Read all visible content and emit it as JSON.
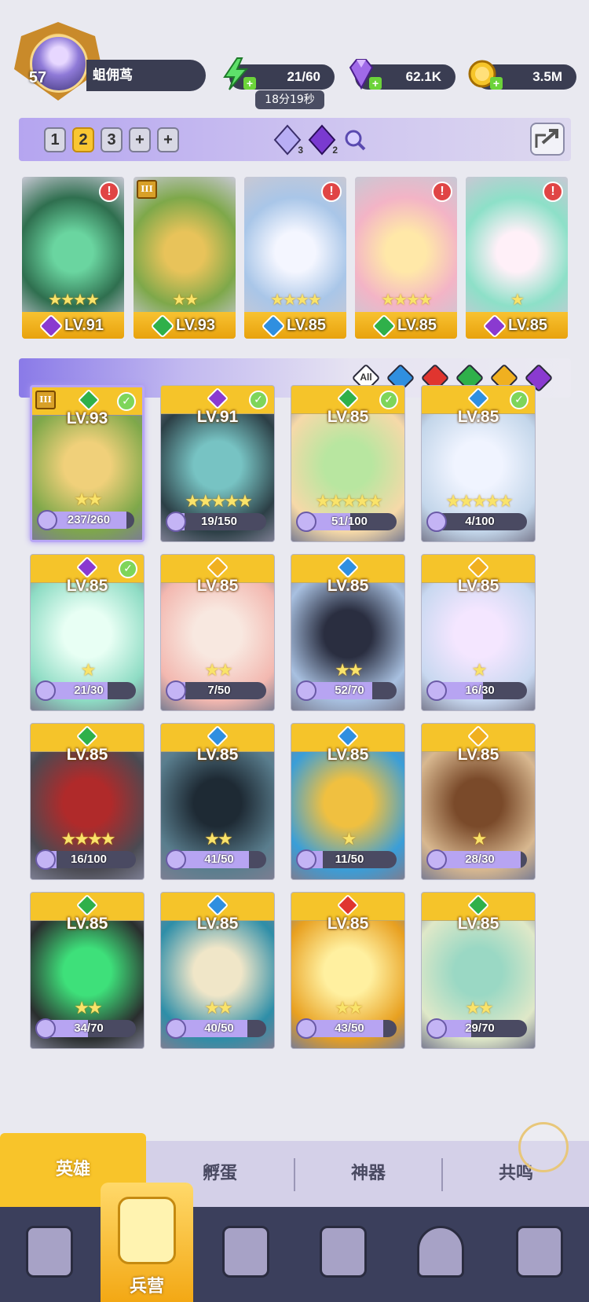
{
  "player": {
    "level": "57",
    "name": "蛆佣茑"
  },
  "resources": {
    "energy": "21/60",
    "energy_timer": "18分19秒",
    "gems": "62.1K",
    "gold": "3.5M"
  },
  "teams": {
    "tabs": [
      "1",
      "2",
      "3",
      "+",
      "+"
    ],
    "active": 1
  },
  "team_gems": [
    {
      "count": "3",
      "color": "#9a8cf0"
    },
    {
      "count": "2",
      "color": "#7a3ad0"
    }
  ],
  "lineup": [
    {
      "level": "LV.91",
      "element": "dark",
      "stars": "★★★★",
      "alert": "!",
      "colors": [
        "#2f6f4f",
        "#6ad5a0"
      ]
    },
    {
      "level": "LV.93",
      "element": "wind",
      "stars": "★★",
      "alert": "",
      "colors": [
        "#7ea84a",
        "#e8c35a"
      ],
      "roman": "III"
    },
    {
      "level": "LV.85",
      "element": "water",
      "stars": "★★★★",
      "alert": "!",
      "colors": [
        "#a9c6e8",
        "#f4f6ff"
      ]
    },
    {
      "level": "LV.85",
      "element": "wind",
      "stars": "★★★★",
      "alert": "!",
      "colors": [
        "#f3b4c6",
        "#ffe8a8"
      ]
    },
    {
      "level": "LV.85",
      "element": "dark",
      "stars": "★",
      "alert": "!",
      "colors": [
        "#8de0c8",
        "#fff0f8"
      ]
    }
  ],
  "filters": [
    {
      "id": "all",
      "label": "All",
      "color": "#ffffff"
    },
    {
      "id": "water",
      "label": "",
      "color": "#2f8fe0"
    },
    {
      "id": "fire",
      "label": "",
      "color": "#e0352f"
    },
    {
      "id": "wind",
      "label": "",
      "color": "#2fb04a"
    },
    {
      "id": "light",
      "label": "",
      "color": "#f0b020"
    },
    {
      "id": "dark",
      "label": "",
      "color": "#8a3ad0"
    }
  ],
  "element_colors": {
    "water": "#2f8fe0",
    "fire": "#e0352f",
    "wind": "#2fb04a",
    "light": "#f0b020",
    "dark": "#8a3ad0"
  },
  "heroes": [
    {
      "level": "LV.93",
      "element": "wind",
      "stars": "★★",
      "shards": "237/260",
      "progress": 0.91,
      "checked": true,
      "selected": true,
      "roman": "III",
      "colors": [
        "#7ea84a",
        "#f0d07a"
      ]
    },
    {
      "level": "LV.91",
      "element": "dark",
      "stars": "★★★★★",
      "shards": "19/150",
      "progress": 0.13,
      "checked": true,
      "colors": [
        "#2c3f46",
        "#77c3c3"
      ]
    },
    {
      "level": "LV.85",
      "element": "wind",
      "stars": "★★★★★",
      "shards": "51/100",
      "progress": 0.51,
      "checked": true,
      "colors": [
        "#f6d9a8",
        "#b8e6a0"
      ]
    },
    {
      "level": "LV.85",
      "element": "water",
      "stars": "★★★★★",
      "shards": "4/100",
      "progress": 0.04,
      "checked": true,
      "colors": [
        "#c3d6ea",
        "#f0f4ff"
      ]
    },
    {
      "level": "LV.85",
      "element": "dark",
      "stars": "★",
      "shards": "21/30",
      "progress": 0.7,
      "checked": true,
      "colors": [
        "#8edcc4",
        "#e8fff4"
      ]
    },
    {
      "level": "LV.85",
      "element": "light",
      "stars": "★★",
      "shards": "7/50",
      "progress": 0.14,
      "checked": false,
      "colors": [
        "#f3b8b0",
        "#f8e8e0"
      ]
    },
    {
      "level": "LV.85",
      "element": "water",
      "stars": "★★",
      "shards": "52/70",
      "progress": 0.74,
      "checked": false,
      "colors": [
        "#a8c0e0",
        "#2a2e40"
      ]
    },
    {
      "level": "LV.85",
      "element": "light",
      "stars": "★",
      "shards": "16/30",
      "progress": 0.53,
      "checked": false,
      "colors": [
        "#c8d8f0",
        "#f4e6ff"
      ]
    },
    {
      "level": "LV.85",
      "element": "wind",
      "stars": "★★★★",
      "shards": "16/100",
      "progress": 0.16,
      "checked": false,
      "colors": [
        "#4a4a52",
        "#b02a2a"
      ]
    },
    {
      "level": "LV.85",
      "element": "water",
      "stars": "★★",
      "shards": "41/50",
      "progress": 0.82,
      "checked": false,
      "colors": [
        "#5a7e8e",
        "#1e2a34"
      ]
    },
    {
      "level": "LV.85",
      "element": "water",
      "stars": "★",
      "shards": "11/50",
      "progress": 0.22,
      "checked": false,
      "colors": [
        "#3a9ed8",
        "#f0c040"
      ]
    },
    {
      "level": "LV.85",
      "element": "light",
      "stars": "★",
      "shards": "28/30",
      "progress": 0.93,
      "checked": false,
      "colors": [
        "#d8b890",
        "#7a4a2a"
      ]
    },
    {
      "level": "LV.85",
      "element": "wind",
      "stars": "★★",
      "shards": "34/70",
      "progress": 0.49,
      "checked": false,
      "colors": [
        "#2a2e2e",
        "#3ee07a"
      ]
    },
    {
      "level": "LV.85",
      "element": "water",
      "stars": "★★",
      "shards": "40/50",
      "progress": 0.8,
      "checked": false,
      "colors": [
        "#2e8ea8",
        "#f0e6c8"
      ]
    },
    {
      "level": "LV.85",
      "element": "fire",
      "stars": "★★",
      "shards": "43/50",
      "progress": 0.86,
      "checked": false,
      "colors": [
        "#e8a020",
        "#fff0a0"
      ]
    },
    {
      "level": "LV.85",
      "element": "wind",
      "stars": "★★",
      "shards": "29/70",
      "progress": 0.41,
      "checked": false,
      "colors": [
        "#dfe8c8",
        "#9ad8c4"
      ]
    }
  ],
  "subtabs": [
    "英雄",
    "孵蛋",
    "神器",
    "共鸣"
  ],
  "subtab_active": 0,
  "nav": {
    "center_label": "兵营"
  }
}
